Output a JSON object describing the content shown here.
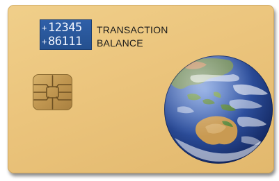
{
  "card": {
    "display": {
      "row1_sign": "+",
      "row1_value": "12345",
      "row2_sign": "+",
      "row2_value": "86111"
    },
    "labels": {
      "transaction": "TRANSACTION",
      "balance": "BALANCE"
    },
    "icons": {
      "chip": "smart-card-chip-icon",
      "globe": "earth-globe-icon"
    },
    "colors": {
      "card": "#ebc47c",
      "display": "#2a5799",
      "chip": "#c9a25a",
      "ocean": "#2f4f9e"
    }
  }
}
